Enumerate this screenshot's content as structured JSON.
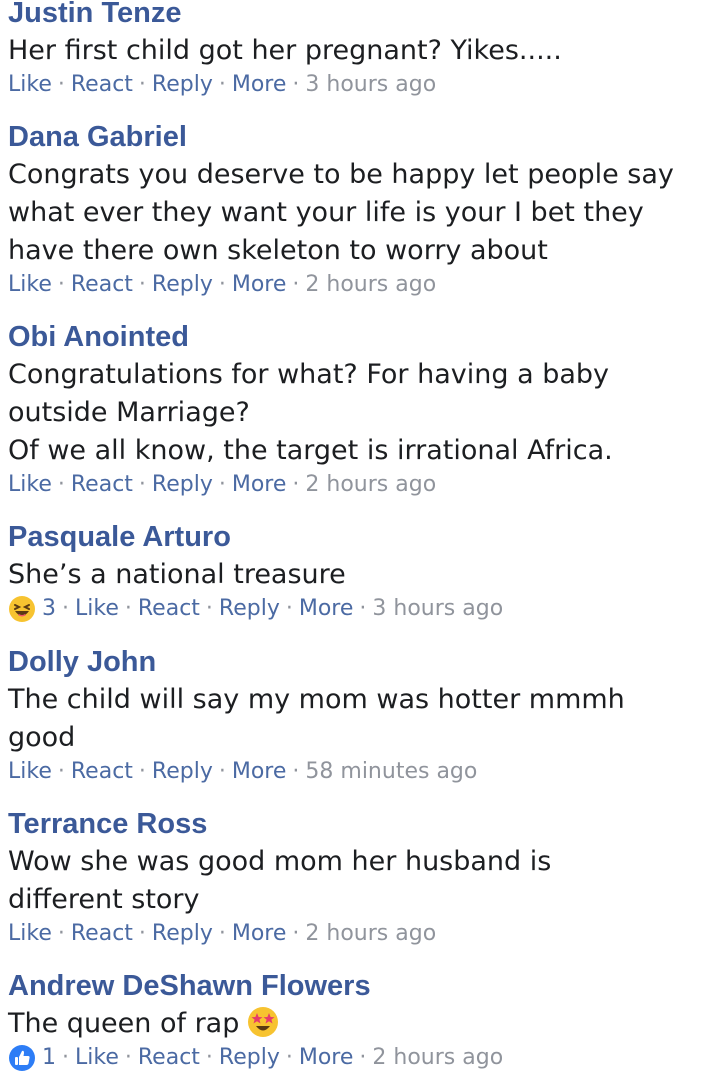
{
  "actions": {
    "like": "Like",
    "react": "React",
    "reply": "Reply",
    "more": "More",
    "separator": "·"
  },
  "colors": {
    "author": "#3b5998",
    "action_link": "#4b6aa3",
    "meta_gray": "#90949c",
    "text": "#1c1e21"
  },
  "comments": [
    {
      "author": "Justin Tenze",
      "lines": [
        "Her first child got her pregnant? Yikes....."
      ],
      "time": "3 hours ago"
    },
    {
      "author": "Dana Gabriel",
      "lines": [
        "Congrats you deserve to be happy let people say",
        "what ever they want your life is your I bet they",
        "have there own skeleton to worry about"
      ],
      "time": "2 hours ago"
    },
    {
      "author": "Obi Anointed",
      "lines": [
        "Congratulations for what? For having a baby",
        "outside Marriage?",
        "Of we all know, the target is irrational Africa."
      ],
      "time": "2 hours ago"
    },
    {
      "author": "Pasquale Arturo",
      "lines": [
        "She’s a national treasure"
      ],
      "reaction": {
        "icon": "laughing-emoji-icon",
        "count": "3"
      },
      "time": "3 hours ago"
    },
    {
      "author": "Dolly John",
      "lines": [
        "The child will say my mom was hotter mmmh",
        "good"
      ],
      "time": "58 minutes ago"
    },
    {
      "author": "Terrance Ross",
      "lines": [
        "Wow she was good mom her husband is",
        "different story"
      ],
      "time": "2 hours ago"
    },
    {
      "author": "Andrew DeShawn Flowers",
      "lines": [
        "The queen of rap"
      ],
      "trailing_emoji": "star-struck-emoji-icon",
      "reaction": {
        "icon": "thumbs-up-icon",
        "count": "1"
      },
      "time": "2 hours ago"
    }
  ]
}
